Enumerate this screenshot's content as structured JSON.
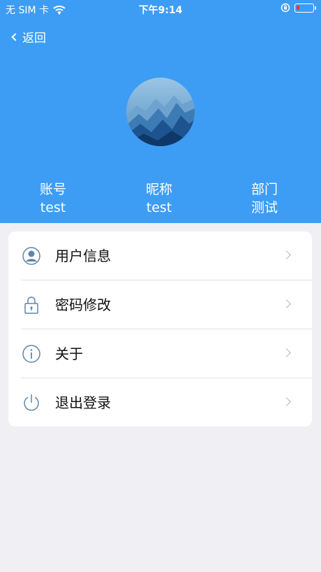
{
  "status": {
    "carrier": "无 SIM 卡",
    "time": "下午9:14"
  },
  "nav": {
    "back_label": "返回"
  },
  "profile": {
    "fields": [
      {
        "label": "账号",
        "value": "test"
      },
      {
        "label": "昵称",
        "value": "test"
      },
      {
        "label": "部门",
        "value": "测试"
      }
    ]
  },
  "menu": {
    "items": [
      {
        "label": "用户信息",
        "icon": "user-icon"
      },
      {
        "label": "密码修改",
        "icon": "lock-icon"
      },
      {
        "label": "关于",
        "icon": "info-icon"
      },
      {
        "label": "退出登录",
        "icon": "power-icon"
      }
    ]
  },
  "colors": {
    "header": "#3d9df5",
    "background": "#efeff4",
    "icon": "#5f86aa"
  }
}
